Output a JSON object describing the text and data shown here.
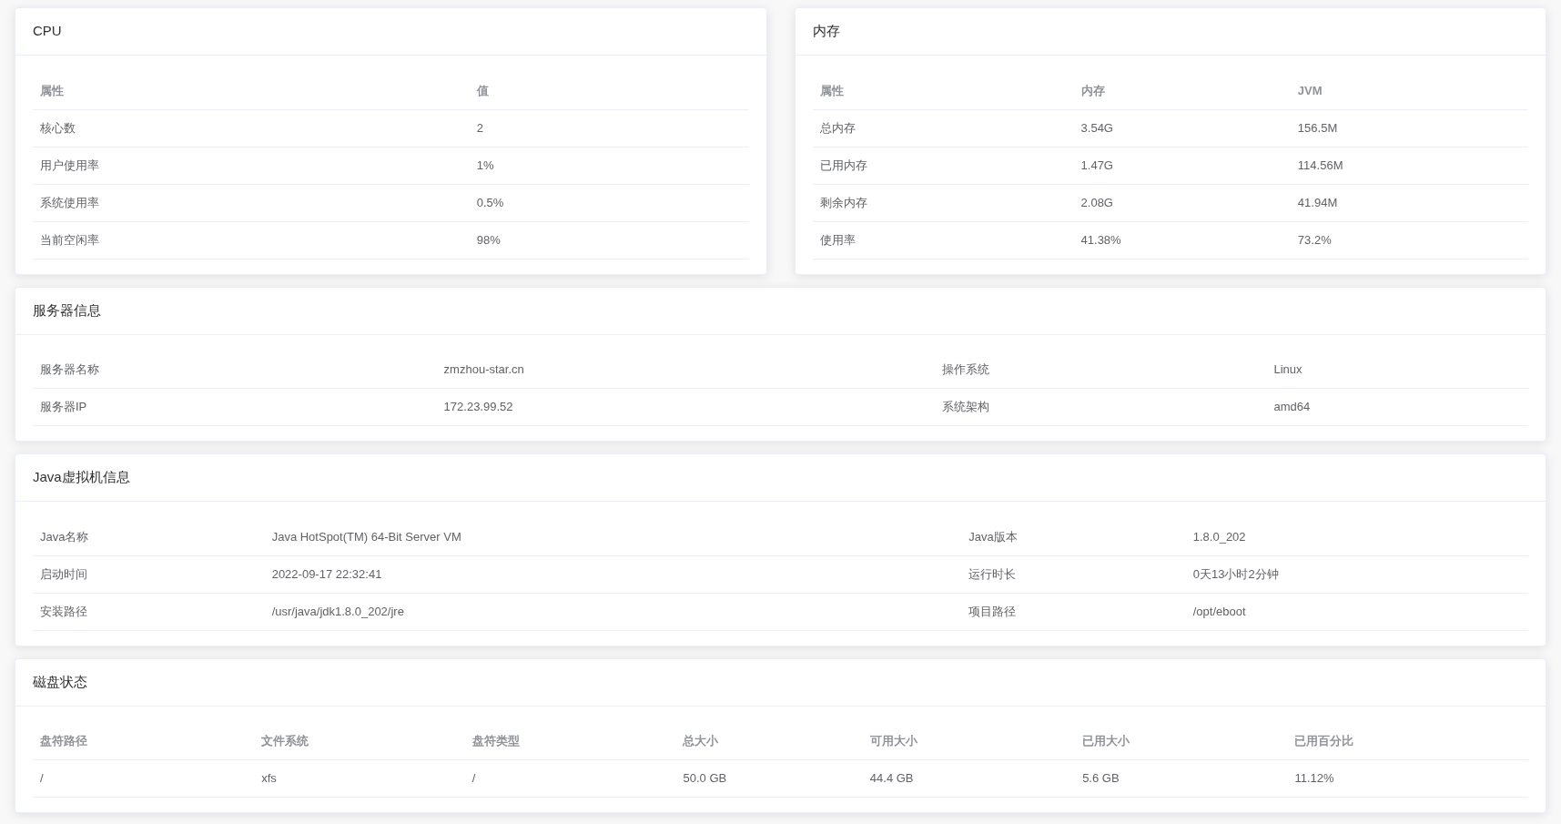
{
  "top_cards": [
    {
      "kind": "cpu",
      "title": "CPU",
      "columns": [
        "属性",
        "值"
      ],
      "rows": [
        [
          "核心数",
          "2"
        ],
        [
          "用户使用率",
          "1%"
        ],
        [
          "系统使用率",
          "0.5%"
        ],
        [
          "当前空闲率",
          "98%"
        ]
      ]
    },
    {
      "kind": "memory",
      "title": "内存",
      "columns": [
        "属性",
        "内存",
        "JVM"
      ],
      "rows": [
        [
          "总内存",
          "3.54G",
          "156.5M"
        ],
        [
          "已用内存",
          "1.47G",
          "114.56M"
        ],
        [
          "剩余内存",
          "2.08G",
          "41.94M"
        ],
        [
          "使用率",
          "41.38%",
          "73.2%"
        ]
      ]
    }
  ],
  "cards": [
    {
      "kind": "server",
      "title": "服务器信息",
      "rows": [
        [
          "服务器名称",
          "zmzhou-star.cn",
          "操作系统",
          "Linux"
        ],
        [
          "服务器IP",
          "172.23.99.52",
          "系统架构",
          "amd64"
        ]
      ]
    },
    {
      "kind": "jvm",
      "title": "Java虚拟机信息",
      "rows": [
        [
          "Java名称",
          "Java HotSpot(TM) 64-Bit Server VM",
          "Java版本",
          "1.8.0_202"
        ],
        [
          "启动时间",
          "2022-09-17 22:32:41",
          "运行时长",
          "0天13小时2分钟"
        ],
        [
          "安装路径",
          "/usr/java/jdk1.8.0_202/jre",
          "项目路径",
          "/opt/eboot"
        ]
      ]
    },
    {
      "kind": "disk",
      "title": "磁盘状态",
      "columns": [
        "盘符路径",
        "文件系统",
        "盘符类型",
        "总大小",
        "可用大小",
        "已用大小",
        "已用百分比"
      ],
      "rows": [
        [
          "/",
          "xfs",
          "/",
          "50.0 GB",
          "44.4 GB",
          "5.6 GB",
          "11.12%"
        ]
      ]
    }
  ]
}
